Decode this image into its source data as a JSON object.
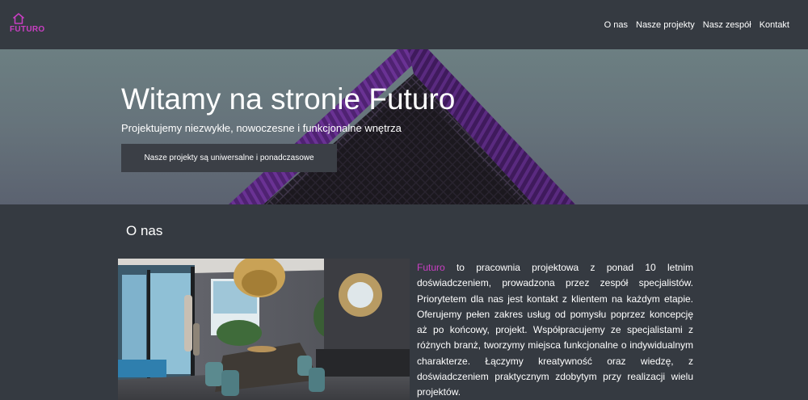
{
  "header": {
    "logo_text": "FUTURO",
    "nav": [
      {
        "label": "O nas"
      },
      {
        "label": "Nasze projekty"
      },
      {
        "label": "Nasz zespół"
      },
      {
        "label": "Kontakt"
      }
    ]
  },
  "hero": {
    "title": "Witamy na stronie Futuro",
    "subtitle": "Projektujemy niezwykłe, nowoczesne i funkcjonalne wnętrza",
    "button_label": "Nasze projekty są uniwersalne i ponadczasowe"
  },
  "about": {
    "section_title": "O nas",
    "brand_word": "Futuro",
    "body": " to pracownia projektowa z ponad 10 letnim doświadczeniem, prowadzona przez zespół specjalistów. Priorytetem dla nas jest kontakt z klientem na każdym etapie. Oferujemy pełen zakres usług od pomysłu poprzez koncepcję aż po końcowy, projekt. Współpracujemy ze specjalistami z różnych branż, tworzymy miejsca funkcjonalne o indywidualnym charakterze. Łączymy kreatywność oraz wiedzę, z doświadczeniem praktycznym zdobytym przy realizacji wielu projektów."
  },
  "colors": {
    "brand": "#c93fc3",
    "background": "#353a41",
    "hero_button": "#3b3f46",
    "roof": "#5a2a7e"
  },
  "icons": {
    "logo": "house-outline-icon"
  }
}
